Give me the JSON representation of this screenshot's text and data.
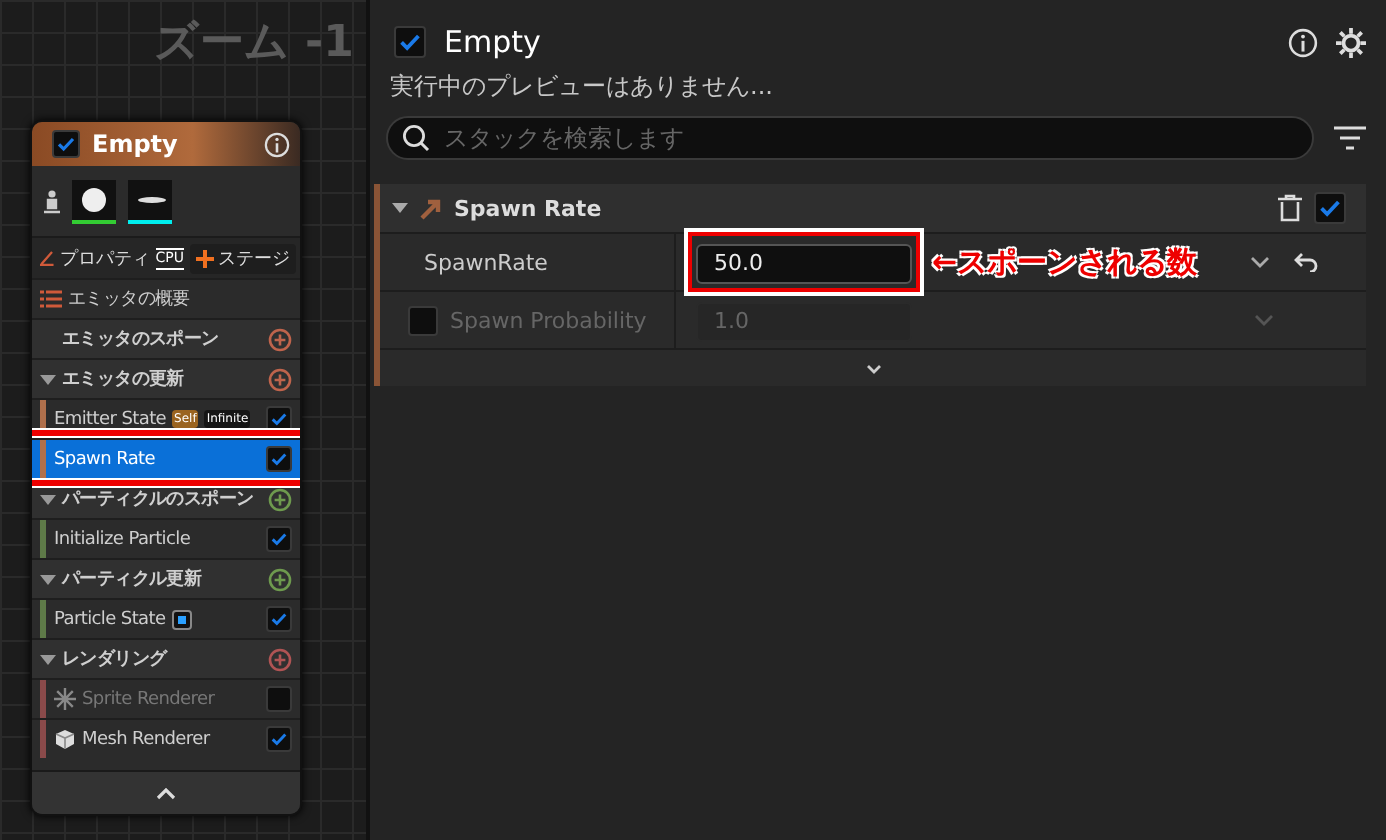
{
  "graph": {
    "zoom_label": "ズーム -1"
  },
  "node": {
    "title": "Empty",
    "checked": true,
    "thumbnails": [
      {
        "kind": "sprite"
      },
      {
        "kind": "mesh"
      }
    ],
    "tabs": [
      {
        "label": "プロパティ",
        "selected": false
      }
    ],
    "sim_target": "CPU",
    "stage_button": "ステージ",
    "items": [
      {
        "kind": "summary",
        "label": "エミッタの概要"
      },
      {
        "kind": "section",
        "label": "エミッタのスポーン",
        "color": "#c0644c"
      },
      {
        "kind": "section",
        "label": "エミッタの更新",
        "color": "#c0644c",
        "expanded": true
      },
      {
        "kind": "module",
        "label": "Emitter State",
        "color": "#b0704c",
        "checked": true,
        "selected": false,
        "enabled": true,
        "badges": [
          {
            "label": "Self",
            "kind": "self"
          },
          {
            "label": "Infinite",
            "kind": "plain"
          }
        ]
      },
      {
        "kind": "module",
        "label": "Spawn Rate",
        "color": "#b0704c",
        "checked": true,
        "selected": true,
        "enabled": true
      },
      {
        "kind": "section",
        "label": "パーティクルのスポーン",
        "color": "#6e9a4e",
        "expanded": true
      },
      {
        "kind": "module",
        "label": "Initialize Particle",
        "color": "#5e7a48",
        "checked": true,
        "selected": false,
        "enabled": true
      },
      {
        "kind": "section",
        "label": "パーティクル更新",
        "color": "#6e9a4e",
        "expanded": true
      },
      {
        "kind": "module",
        "label": "Particle State",
        "color": "#5e7a48",
        "checked": true,
        "selected": false,
        "enabled": true,
        "badges": [
          {
            "kind": "dot"
          }
        ]
      },
      {
        "kind": "section",
        "label": "レンダリング",
        "color": "#b05454",
        "expanded": true
      },
      {
        "kind": "sprite",
        "label": "Sprite Renderer",
        "color": "#8a4a4a",
        "checked": false,
        "selected": false,
        "enabled": false
      },
      {
        "kind": "mesh",
        "label": "Mesh Renderer",
        "color": "#8a4a4a",
        "checked": true,
        "selected": false,
        "enabled": true
      }
    ]
  },
  "stack": {
    "title": "Empty",
    "checked": true,
    "status": "実行中のプレビューはありません...",
    "search": {
      "placeholder": "スタックを検索します"
    },
    "module": {
      "name": "Spawn Rate",
      "checked": true,
      "expanded": true,
      "params": [
        {
          "label": "SpawnRate",
          "value": "50.0",
          "enabled": true,
          "highlighted": true,
          "annotation": "←スポーンされる数"
        },
        {
          "label": "Spawn Probability",
          "value": "1.0",
          "enabled": false,
          "checked": false,
          "highlighted": false
        }
      ]
    }
  }
}
